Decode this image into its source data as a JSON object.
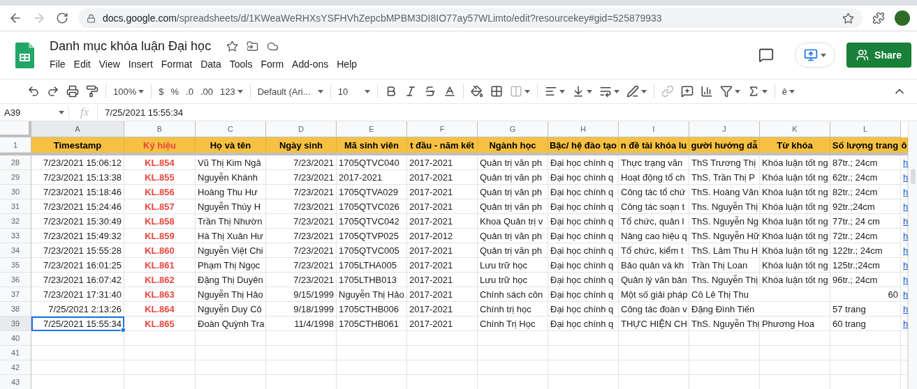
{
  "browser": {
    "url_host": "docs.google.com",
    "url_path": "/spreadsheets/d/1KWeaWeRHXsYSFHVhZepcbMPBM3DI8IO77ay57WLimto/edit?resourcekey#gid=525879933"
  },
  "document": {
    "title": "Danh mục khóa luận Đại học"
  },
  "menu": [
    "File",
    "Edit",
    "View",
    "Insert",
    "Format",
    "Data",
    "Tools",
    "Form",
    "Add-ons",
    "Help"
  ],
  "share_button": "Share",
  "toolbar": {
    "zoom": "100%",
    "currency": "$",
    "percent": "%",
    "decrease_decimals": ".0",
    "increase_decimals": ".00",
    "number_format": "123",
    "font": "Default (Ari...",
    "font_size": "10",
    "input_tools": "ê"
  },
  "formula_bar": {
    "cell": "A39",
    "fx": "fx",
    "value": "7/25/2021 15:55:34"
  },
  "column_letters": [
    {
      "label": "A",
      "selected": true
    },
    {
      "label": "B",
      "selected": false
    },
    {
      "label": "C",
      "selected": false
    },
    {
      "label": "D",
      "selected": false
    },
    {
      "label": "E",
      "selected": false
    },
    {
      "label": "F",
      "selected": false
    },
    {
      "label": "G",
      "selected": false
    },
    {
      "label": "H",
      "selected": false
    },
    {
      "label": "I",
      "selected": false
    },
    {
      "label": "J",
      "selected": false
    },
    {
      "label": "K",
      "selected": false
    },
    {
      "label": "L",
      "selected": false
    }
  ],
  "header_row": {
    "number": "1",
    "cells": [
      {
        "text": "Timestamp"
      },
      {
        "text": "Ký hiệu",
        "color": "#e8453c"
      },
      {
        "text": "Họ và tên"
      },
      {
        "text": "Ngày sinh"
      },
      {
        "text": "Mã sinh viên"
      },
      {
        "text": "t đầu - năm kết"
      },
      {
        "text": "Ngành học"
      },
      {
        "text": "Bậc/ hệ đào tạo"
      },
      {
        "text": "n đề tài khóa lu"
      },
      {
        "text": "gười hướng dẫ"
      },
      {
        "text": "Từ khóa"
      },
      {
        "text": "Số lượng trang"
      },
      {
        "text": "ô"
      }
    ]
  },
  "rows": [
    {
      "number": "28",
      "selected": false,
      "cells": [
        {
          "text": "7/23/2021 15:06:12",
          "kind": "number"
        },
        {
          "text": "KL.854",
          "kind": "code",
          "color": "#e8453c"
        },
        "Vũ Thị Kim Ngâ",
        {
          "text": "7/23/2021",
          "kind": "number"
        },
        "1705QTVC040",
        "2017-2021",
        "Quản trị văn ph",
        "Đại học chính q",
        "Thực trạng văn",
        "ThS Trương Thị",
        "Khóa luận tốt ng",
        "87tr.; 24cm",
        {
          "text": "h",
          "kind": "link"
        }
      ]
    },
    {
      "number": "29",
      "selected": false,
      "cells": [
        {
          "text": "7/23/2021 15:13:38",
          "kind": "number"
        },
        {
          "text": "KL.855",
          "kind": "code",
          "color": "#e8453c"
        },
        "Nguyễn Khánh",
        {
          "text": "7/23/2021",
          "kind": "number"
        },
        "2017-2021",
        "2017-2021",
        "Quản trị văn ph",
        "Đại học chính q",
        "Hoạt động tổ ch",
        "ThS. Trần Thị P",
        "Khóa luận tốt ng",
        "62tr.; 24cm",
        {
          "text": "h",
          "kind": "link"
        }
      ]
    },
    {
      "number": "30",
      "selected": false,
      "cells": [
        {
          "text": "7/23/2021 15:18:46",
          "kind": "number"
        },
        {
          "text": "KL.856",
          "kind": "code",
          "color": "#e8453c"
        },
        "Hoàng Thu Hư",
        {
          "text": "7/23/2021",
          "kind": "number"
        },
        "1705QTVA029",
        "2017-2021",
        "Quản trị văn ph",
        "Đại học chính q",
        "Công tác tổ chứ",
        "ThS. Hoàng Văn",
        "Khóa luận tốt ng",
        "82tr.; 24cm",
        {
          "text": "h",
          "kind": "link"
        }
      ]
    },
    {
      "number": "31",
      "selected": false,
      "cells": [
        {
          "text": "7/23/2021 15:24:46",
          "kind": "number"
        },
        {
          "text": "KL.857",
          "kind": "code",
          "color": "#e8453c"
        },
        "Nguyễn Thúy H",
        {
          "text": "7/23/2021",
          "kind": "number"
        },
        "1705QTVC026",
        "2017-2021",
        "Quản trị văn ph",
        "Đại học chính q",
        "Công tác soạn t",
        "Ths. Nguyễn Thị",
        "Khóa luận tốt ng",
        "92tr.;24cm",
        {
          "text": "h",
          "kind": "link"
        }
      ]
    },
    {
      "number": "32",
      "selected": false,
      "cells": [
        {
          "text": "7/23/2021 15:30:49",
          "kind": "number"
        },
        {
          "text": "KL.858",
          "kind": "code",
          "color": "#e8453c"
        },
        "Trần Thị Nhườn",
        {
          "text": "7/23/2021",
          "kind": "number"
        },
        "1705QTVC042",
        "2017-2021",
        "Khoa Quản trị v",
        "Đại học chính q",
        "Tổ chức, quản l",
        "ThS. Nguyễn Ng",
        "Khóa luận tốt ng",
        "77tr.; 24 cm",
        {
          "text": "h",
          "kind": "link"
        }
      ]
    },
    {
      "number": "33",
      "selected": false,
      "cells": [
        {
          "text": "7/23/2021 15:49:32",
          "kind": "number"
        },
        {
          "text": "KL.859",
          "kind": "code",
          "color": "#e8453c"
        },
        "Hà Thị Xuân Hư",
        {
          "text": "7/23/2021",
          "kind": "number"
        },
        "1705QTVP025",
        "2017-2012",
        "Quản trị văn ph",
        "Đại học chính q",
        "Nâng cao hiệu q",
        "ThS. Nguyễn Hữ",
        "Khóa luận tốt ng",
        "72tr.; 24cm",
        {
          "text": "h",
          "kind": "link"
        }
      ]
    },
    {
      "number": "34",
      "selected": false,
      "cells": [
        {
          "text": "7/23/2021 15:55:28",
          "kind": "number"
        },
        {
          "text": "KL.860",
          "kind": "code",
          "color": "#e8453c"
        },
        "Nguyễn Việt Chi",
        {
          "text": "7/23/2021",
          "kind": "number"
        },
        "1705QTVC005",
        "2017-2021",
        "Quản trị văn ph",
        "Đại học chính q",
        "Tổ chức, kiểm t",
        "ThS. Lâm Thu H",
        "Khóa luận tốt ng",
        "122tr.; 24cm",
        {
          "text": "h",
          "kind": "link"
        }
      ]
    },
    {
      "number": "35",
      "selected": false,
      "cells": [
        {
          "text": "7/23/2021 16:01:25",
          "kind": "number"
        },
        {
          "text": "KL.861",
          "kind": "code",
          "color": "#e8453c"
        },
        "Phạm Thị Ngọc",
        {
          "text": "7/23/2021",
          "kind": "number"
        },
        "1705LTHA005",
        "2017-2021",
        "Lưu trữ học",
        "Đại học chính q",
        "Bảo quản và kh",
        "Trần Thị Loan",
        "Khóa luận tốt ng",
        "125tr.;24cm",
        {
          "text": "h",
          "kind": "link"
        }
      ]
    },
    {
      "number": "36",
      "selected": false,
      "cells": [
        {
          "text": "7/23/2021 16:07:42",
          "kind": "number"
        },
        {
          "text": "KL.862",
          "kind": "code",
          "color": "#e8453c"
        },
        "Đặng Thị Duyên",
        {
          "text": "7/23/2021",
          "kind": "number"
        },
        "1705LTHB013",
        "2017-2021",
        "Lưu trữ học",
        "Đại học chính q",
        "Quản lý văn bản",
        "Ths. Nguyễn Thị",
        "Khóa luận tốt ng",
        "96tr.; 24cm",
        {
          "text": "h",
          "kind": "link"
        }
      ]
    },
    {
      "number": "37",
      "selected": false,
      "cells": [
        {
          "text": "7/23/2021 17:31:40",
          "kind": "number"
        },
        {
          "text": "KL.863",
          "kind": "code",
          "color": "#e8453c"
        },
        "Nguyễn Thị Hảo",
        {
          "text": "9/15/1999",
          "kind": "number"
        },
        "Nguyễn Thị Hảo",
        "2017-2021",
        "Chính sách côn",
        "Đại học chính q",
        "Một số giải pháp",
        "Cô Lê Thị Thu",
        "",
        {
          "text": "60",
          "kind": "number"
        },
        {
          "text": "h",
          "kind": "link"
        }
      ]
    },
    {
      "number": "38",
      "selected": false,
      "cells": [
        {
          "text": "7/25/2021 2:13:26",
          "kind": "number"
        },
        {
          "text": "KL.864",
          "kind": "code",
          "color": "#e8453c"
        },
        "Nguyễn Duy Cô",
        {
          "text": "9/18/1999",
          "kind": "number"
        },
        "1705CTHB006",
        "2017-2021",
        "Chính trị học",
        "Đại học chính q",
        "Công tác đoàn v",
        "Đặng Đình Tiến",
        "",
        "57 trang",
        {
          "text": "h",
          "kind": "link"
        }
      ]
    },
    {
      "number": "39",
      "selected": true,
      "cells": [
        {
          "text": "7/25/2021 15:55:34",
          "kind": "number"
        },
        {
          "text": "KL.865",
          "kind": "code",
          "color": "#e8453c"
        },
        "Đoàn Quỳnh Tra",
        {
          "text": "11/4/1998",
          "kind": "number"
        },
        "1705CTHB061",
        "2017-2021",
        "Chính Trị Học",
        "Đại học chính q",
        "THỰC HIỆN CH",
        "ThS. Nguyễn Thị Phương Hoa",
        "",
        "60 trang",
        {
          "text": "h",
          "kind": "link"
        }
      ]
    },
    {
      "number": "40",
      "selected": false,
      "cells": []
    },
    {
      "number": "41",
      "selected": false,
      "cells": []
    },
    {
      "number": "42",
      "selected": false,
      "cells": []
    },
    {
      "number": "43",
      "selected": false,
      "cells": []
    }
  ]
}
